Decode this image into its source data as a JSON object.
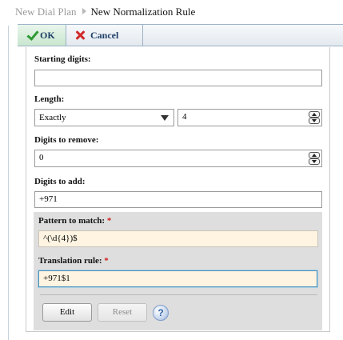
{
  "breadcrumb": {
    "parent": "New Dial Plan",
    "current": "New Normalization Rule"
  },
  "toolbar": {
    "ok_label": "OK",
    "cancel_label": "Cancel"
  },
  "form": {
    "starting_digits": {
      "label": "Starting digits:",
      "value": ""
    },
    "length": {
      "label": "Length:",
      "mode": "Exactly",
      "value": "4"
    },
    "digits_to_remove": {
      "label": "Digits to remove:",
      "value": "0"
    },
    "digits_to_add": {
      "label": "Digits to add:",
      "value": "+971"
    },
    "pattern_to_match": {
      "label": "Pattern to match:",
      "required_mark": "*",
      "value": "^(\\d{4})$"
    },
    "translation_rule": {
      "label": "Translation rule:",
      "required_mark": "*",
      "value": "+971$1"
    }
  },
  "buttons": {
    "edit": "Edit",
    "reset": "Reset",
    "help": "?"
  },
  "colors": {
    "ok_green": "#2f9a36",
    "cancel_red": "#d12b2b",
    "required_red": "#d02020",
    "toolbar_text": "#1d3f66",
    "highlight_field_bg": "#fff4e2"
  }
}
